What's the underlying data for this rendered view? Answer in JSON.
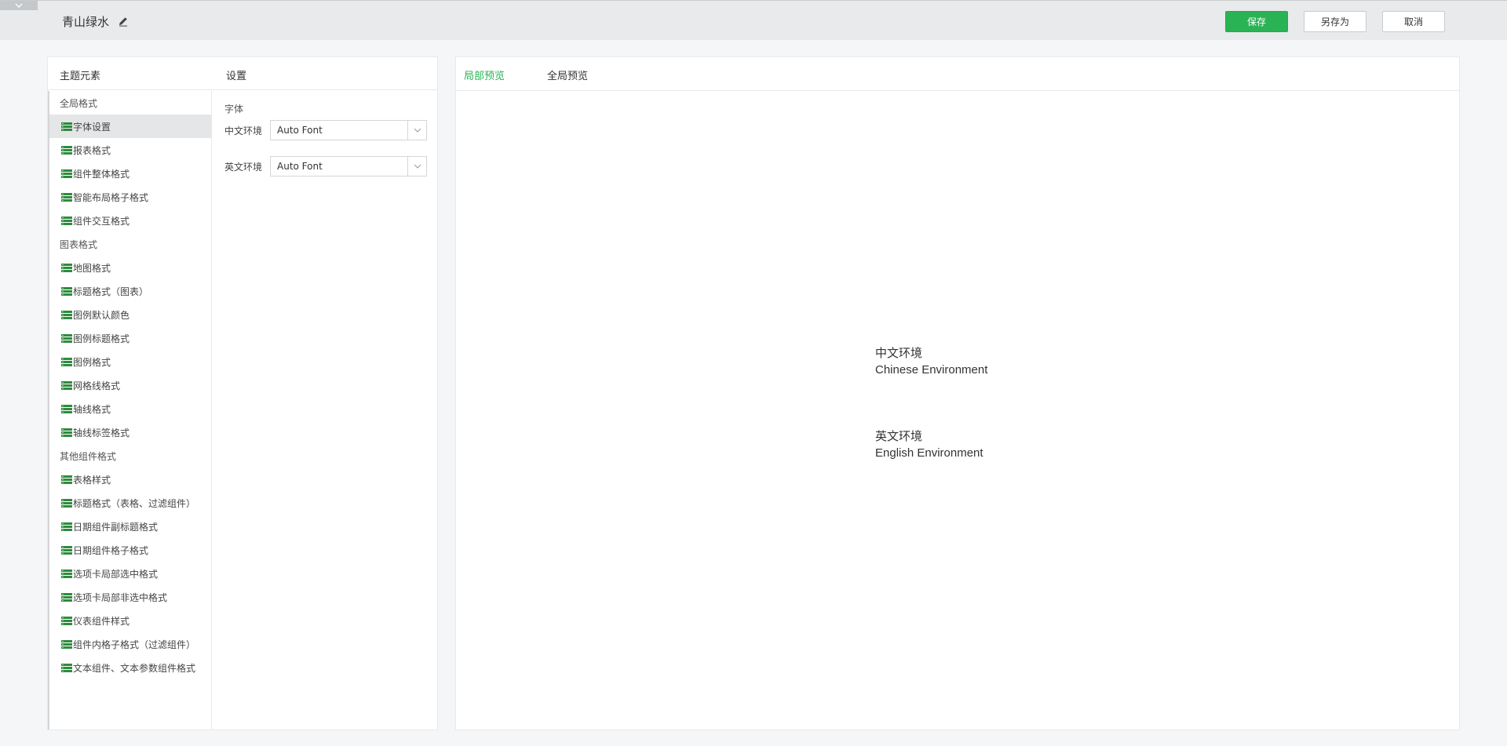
{
  "header": {
    "theme_name": "青山绿水",
    "save_label": "保存",
    "save_as_label": "另存为",
    "cancel_label": "取消"
  },
  "left_panel": {
    "elements_title": "主题元素",
    "settings_title": "设置",
    "groups": [
      {
        "label": "全局格式",
        "items": [
          "字体设置",
          "报表格式",
          "组件整体格式",
          "智能布局格子格式",
          "组件交互格式"
        ]
      },
      {
        "label": "图表格式",
        "items": [
          "地图格式",
          "标题格式（图表）",
          "图例默认颜色",
          "图例标题格式",
          "图例格式",
          "网格线格式",
          "轴线格式",
          "轴线标签格式"
        ]
      },
      {
        "label": "其他组件格式",
        "items": [
          "表格样式",
          "标题格式（表格、过滤组件）",
          "日期组件副标题格式",
          "日期组件格子格式",
          "选项卡局部选中格式",
          "选项卡局部非选中格式",
          "仪表组件样式",
          "组件内格子格式（过滤组件）",
          "文本组件、文本参数组件格式"
        ]
      }
    ],
    "active_item": "字体设置",
    "settings": {
      "section_label": "字体",
      "cn_env_label": "中文环境",
      "cn_env_value": "Auto Font",
      "en_env_label": "英文环境",
      "en_env_value": "Auto Font"
    }
  },
  "right_panel": {
    "tabs": [
      {
        "label": "局部预览",
        "active": true
      },
      {
        "label": "全局预览",
        "active": false
      }
    ],
    "preview": {
      "cn_title": "中文环境",
      "cn_sub": "Chinese Environment",
      "en_title": "英文环境",
      "en_sub": "English Environment"
    }
  },
  "colors": {
    "accent": "#2ab355",
    "icon_green": "#2e8b3e"
  }
}
